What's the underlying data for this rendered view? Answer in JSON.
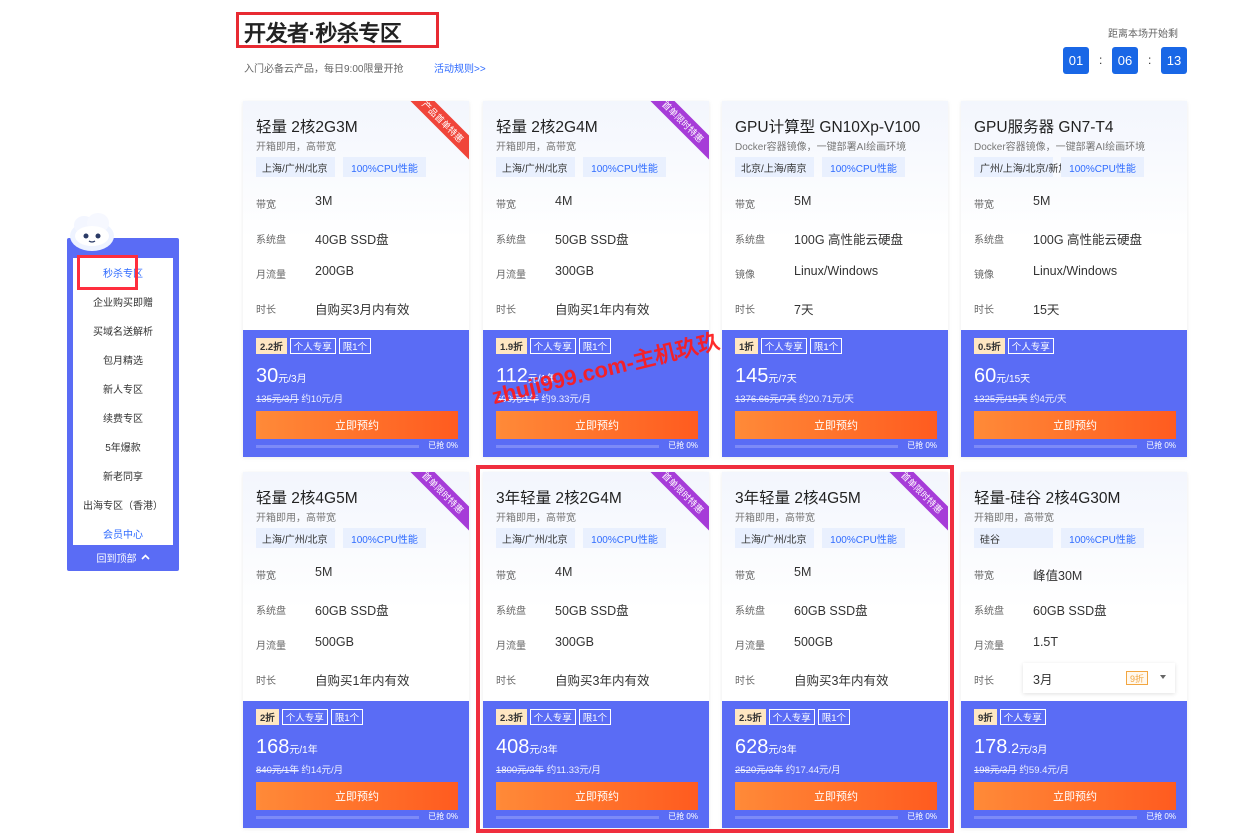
{
  "header": {
    "title": "开发者·秒杀专区",
    "subtitle": "入门必备云产品，每日9:00限量开抢",
    "rules_link": "活动规则>>",
    "countdown_label": "距离本场开始剩",
    "countdown": [
      "01",
      "06",
      "13"
    ],
    "countdown_sep": ":"
  },
  "sidebar": {
    "items": [
      "秒杀专区",
      "企业购买即赠",
      "买域名送解析",
      "包月精选",
      "新人专区",
      "续费专区",
      "5年爆款",
      "新老同享",
      "出海专区（香港）",
      "会员中心"
    ],
    "back_top": "回到顶部",
    "back_icon": "^"
  },
  "labels": {
    "bandwidth": "带宽",
    "disk": "系统盘",
    "traffic": "月流量",
    "image": "镜像",
    "duration": "时长",
    "personal": "个人专享",
    "limit": "限1个",
    "buy": "立即预约",
    "progress": "已抢 0%"
  },
  "watermark": "zhuji999.com-主机玖玖",
  "cards": [
    {
      "name": "轻量 2核2G3M",
      "desc": "开箱即用，高带宽",
      "loc": "上海/广州/北京",
      "cpu": "100%CPU性能",
      "ribbon": "产品首单特惠",
      "ribbon_color": "#f0453a",
      "s1": "3M",
      "s2": "40GB SSD盘",
      "s3k": "月流量",
      "s3": "200GB",
      "s4": "自购买3月内有效",
      "disc": "2.2折",
      "price": "30",
      "unit": "元/3月",
      "orig": "135元/3月",
      "per": " 约10元/月"
    },
    {
      "name": "轻量 2核2G4M",
      "desc": "开箱即用，高带宽",
      "loc": "上海/广州/北京",
      "cpu": "100%CPU性能",
      "ribbon": "首单限时特惠",
      "ribbon_color": "#a63cd8",
      "s1": "4M",
      "s2": "50GB SSD盘",
      "s3k": "月流量",
      "s3": "300GB",
      "s4": "自购买1年内有效",
      "disc": "1.9折",
      "price": "112",
      "unit": "元/1年",
      "orig": "600元/1年",
      "per": " 约9.33元/月"
    },
    {
      "name": "GPU计算型 GN10Xp-V100",
      "desc": "Docker容器镜像，一键部署AI绘画环境",
      "loc": "北京/上海/南京",
      "cpu": "100%CPU性能",
      "ribbon": "",
      "ribbon_color": "",
      "s1": "5M",
      "s2": "100G 高性能云硬盘",
      "s3k": "镜像",
      "s3": "Linux/Windows",
      "s4": "7天",
      "disc": "1折",
      "price": "145",
      "unit": "元/7天",
      "orig": "1376.66元/7天",
      "per": " 约20.71元/天"
    },
    {
      "name": "GPU服务器 GN7-T4",
      "desc": "Docker容器镜像，一键部署AI绘画环境",
      "loc": "广州/上海/北京/新加...",
      "cpu": "100%CPU性能",
      "ribbon": "",
      "ribbon_color": "",
      "s1": "5M",
      "s2": "100G 高性能云硬盘",
      "s3k": "镜像",
      "s3": "Linux/Windows",
      "s4": "15天",
      "disc": "0.5折",
      "price": "60",
      "unit": "元/15天",
      "orig": "1325元/15天",
      "per": " 约4元/天",
      "no_limit": true
    },
    {
      "name": "轻量 2核4G5M",
      "desc": "开箱即用，高带宽",
      "loc": "上海/广州/北京",
      "cpu": "100%CPU性能",
      "ribbon": "首单限时特惠",
      "ribbon_color": "#a63cd8",
      "s1": "5M",
      "s2": "60GB SSD盘",
      "s3k": "月流量",
      "s3": "500GB",
      "s4": "自购买1年内有效",
      "disc": "2折",
      "price": "168",
      "unit": "元/1年",
      "orig": "840元/1年",
      "per": " 约14元/月"
    },
    {
      "name": "3年轻量 2核2G4M",
      "desc": "开箱即用，高带宽",
      "loc": "上海/广州/北京",
      "cpu": "100%CPU性能",
      "ribbon": "首单限时特惠",
      "ribbon_color": "#a63cd8",
      "s1": "4M",
      "s2": "50GB SSD盘",
      "s3k": "月流量",
      "s3": "300GB",
      "s4": "自购买3年内有效",
      "disc": "2.3折",
      "price": "408",
      "unit": "元/3年",
      "orig": "1800元/3年",
      "per": " 约11.33元/月"
    },
    {
      "name": "3年轻量 2核4G5M",
      "desc": "开箱即用，高带宽",
      "loc": "上海/广州/北京",
      "cpu": "100%CPU性能",
      "ribbon": "首单限时特惠",
      "ribbon_color": "#a63cd8",
      "s1": "5M",
      "s2": "60GB SSD盘",
      "s3k": "月流量",
      "s3": "500GB",
      "s4": "自购买3年内有效",
      "disc": "2.5折",
      "price": "628",
      "unit": "元/3年",
      "orig": "2520元/3年",
      "per": " 约17.44元/月"
    },
    {
      "name": "轻量-硅谷 2核4G30M",
      "desc": "开箱即用，高带宽",
      "loc": "硅谷",
      "cpu": "100%CPU性能",
      "ribbon": "",
      "ribbon_color": "",
      "s1": "峰值30M",
      "s2": "60GB SSD盘",
      "s3k": "月流量",
      "s3": "1.5T",
      "s4": "3月",
      "select_badge": "9折",
      "disc": "9折",
      "price": "178",
      "price_dec": ".2",
      "unit": "元/3月",
      "orig": "198元/3月",
      "per": " 约59.4元/月",
      "no_limit": true
    }
  ]
}
